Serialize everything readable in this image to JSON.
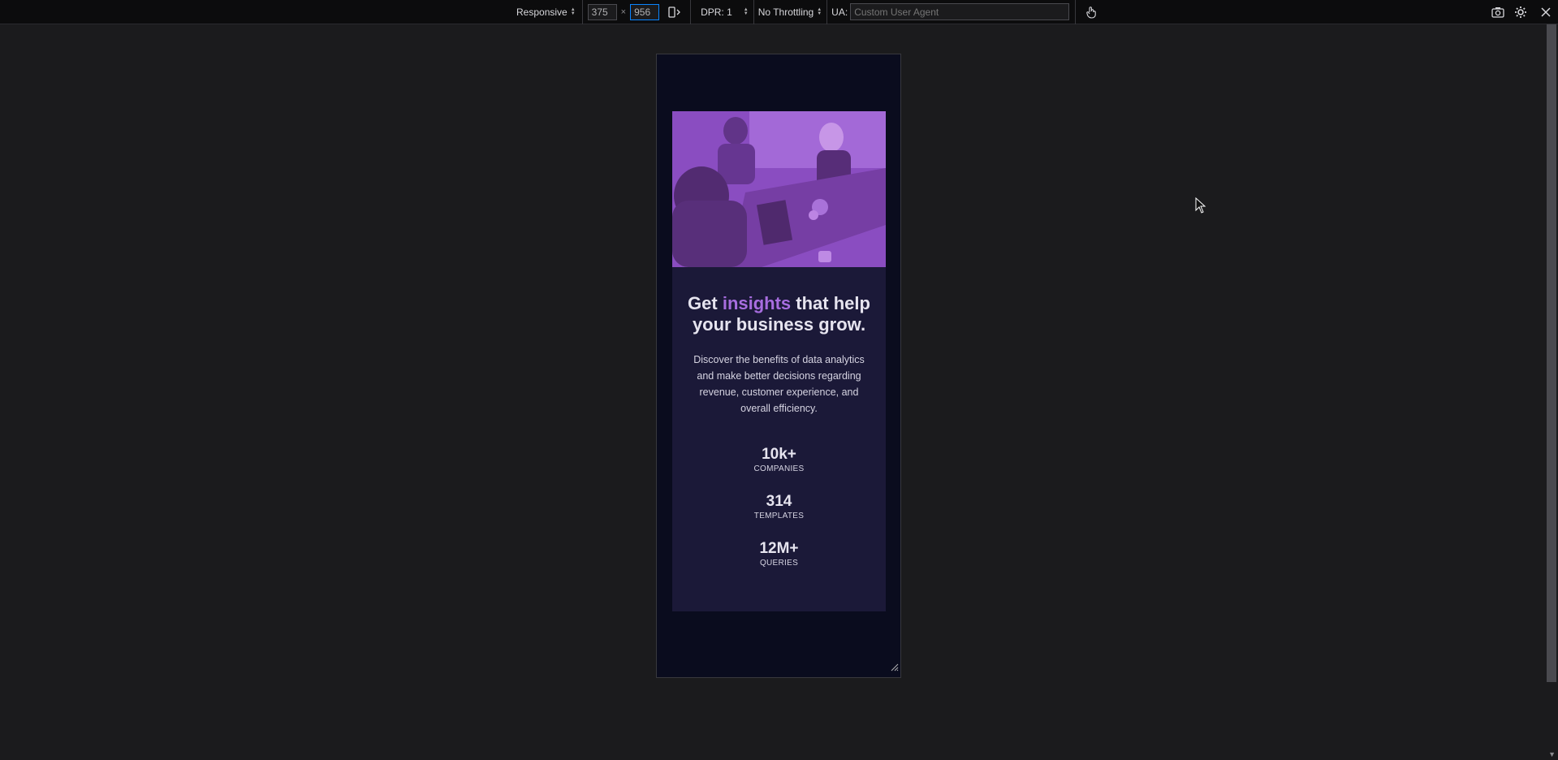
{
  "toolbar": {
    "device_mode": "Responsive",
    "width": "375",
    "height": "956",
    "dpr": "DPR: 1",
    "throttling": "No Throttling",
    "ua_label": "UA:",
    "ua_placeholder": "Custom User Agent"
  },
  "card": {
    "headline_pre": "Get ",
    "headline_accent": "insights",
    "headline_post": " that help your business grow.",
    "description": "Discover the benefits of data analytics and make better decisions regarding revenue, customer experience, and overall efficiency.",
    "stats": [
      {
        "value": "10k+",
        "label": "COMPANIES"
      },
      {
        "value": "314",
        "label": "TEMPLATES"
      },
      {
        "value": "12M+",
        "label": "QUERIES"
      }
    ]
  },
  "colors": {
    "page_bg": "#0a0c1e",
    "card_bg": "#1b1938",
    "accent": "#a76ddf",
    "devtools_bg": "#1b1b1d"
  }
}
